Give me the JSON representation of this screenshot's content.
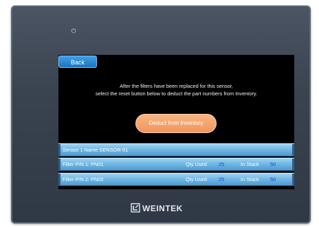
{
  "device": {
    "power_icon": "power-icon",
    "brand": "WEINTEK"
  },
  "screen": {
    "back_label": "Back",
    "instruction_lines": [
      "After the filters have been replaced for this sensor,",
      "select the reset button below to deduct the part numbers from Inventory."
    ],
    "deduct_label": "Deduct from Inventory",
    "sensor_row": {
      "label": "Sensor 1 Name SENSOR-01"
    },
    "filters": [
      {
        "label": "Filter P/N 1: PN01",
        "qty_label": "Qty Used",
        "qty_value": "25",
        "stock_label": "In Stack",
        "stock_value": "50"
      },
      {
        "label": "Filter P/N 2: PN02",
        "qty_label": "Qty Used",
        "qty_value": "25",
        "stock_label": "In Stack",
        "stock_value": "50"
      }
    ]
  },
  "colors": {
    "bezel": "#3a4350",
    "screen": "#000000",
    "back_button": "#1b74c0",
    "deduct_button": "#f0955a",
    "row_bar": "#6fb5e3",
    "value_text": "#1a3fd0"
  }
}
